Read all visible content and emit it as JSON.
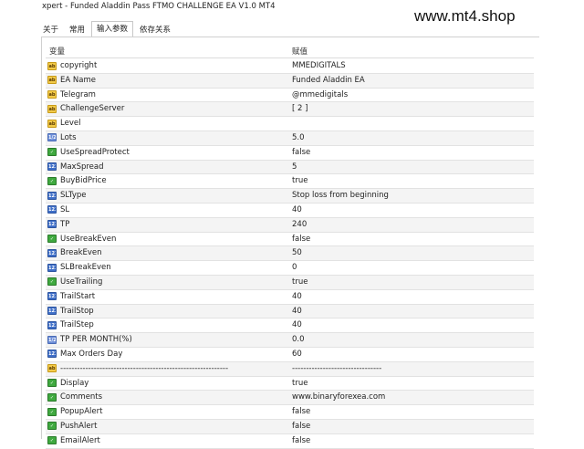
{
  "window": {
    "title": "xpert - Funded Aladdin Pass FTMO CHALLENGE EA V1.0 MT4",
    "watermark": "www.mt4.shop"
  },
  "tabs": [
    {
      "label": "关于"
    },
    {
      "label": "常用"
    },
    {
      "label": "输入参数"
    },
    {
      "label": "依存关系"
    }
  ],
  "active_tab": "输入参数",
  "columns": {
    "name": "变量",
    "value": "赋值"
  },
  "params": [
    {
      "icon": "text-type-icon",
      "name": "copyright",
      "value": "MMEDIGITALS"
    },
    {
      "icon": "text-type-icon",
      "name": "EA Name",
      "value": "Funded Aladdin EA"
    },
    {
      "icon": "text-type-icon",
      "name": "Telegram",
      "value": " @mmedigitals"
    },
    {
      "icon": "text-type-icon",
      "name": "ChallengeServer",
      "value": "[ 2 ]"
    },
    {
      "icon": "text-type-icon",
      "name": "Level",
      "value": ""
    },
    {
      "icon": "double-type-icon",
      "name": "Lots",
      "value": "5.0"
    },
    {
      "icon": "bool-type-icon",
      "name": "UseSpreadProtect",
      "value": "false"
    },
    {
      "icon": "int-type-icon",
      "name": "MaxSpread",
      "value": "5"
    },
    {
      "icon": "bool-type-icon",
      "name": "BuyBidPrice",
      "value": "true"
    },
    {
      "icon": "int-type-icon",
      "name": "SLType",
      "value": "Stop loss from beginning"
    },
    {
      "icon": "int-type-icon",
      "name": "SL",
      "value": "40"
    },
    {
      "icon": "int-type-icon",
      "name": "TP",
      "value": "240"
    },
    {
      "icon": "bool-type-icon",
      "name": "UseBreakEven",
      "value": "false"
    },
    {
      "icon": "int-type-icon",
      "name": "BreakEven",
      "value": "50"
    },
    {
      "icon": "int-type-icon",
      "name": "SLBreakEven",
      "value": "0"
    },
    {
      "icon": "bool-type-icon",
      "name": "UseTrailing",
      "value": "true"
    },
    {
      "icon": "int-type-icon",
      "name": "TrailStart",
      "value": "40"
    },
    {
      "icon": "int-type-icon",
      "name": "TrailStop",
      "value": "40"
    },
    {
      "icon": "int-type-icon",
      "name": "TrailStep",
      "value": "40"
    },
    {
      "icon": "double-type-icon",
      "name": "TP PER MONTH(%)",
      "value": "0.0"
    },
    {
      "icon": "int-type-icon",
      "name": "Max Orders Day",
      "value": "60"
    },
    {
      "icon": "text-type-icon",
      "name": "------------------------------------------------------------",
      "value": "--------------------------------"
    },
    {
      "icon": "bool-type-icon",
      "name": "Display",
      "value": "true"
    },
    {
      "icon": "bool-type-icon",
      "name": "Comments",
      "value": "www.binaryforexea.com"
    },
    {
      "icon": "bool-type-icon",
      "name": "PopupAlert",
      "value": "false"
    },
    {
      "icon": "bool-type-icon",
      "name": "PushAlert",
      "value": "false"
    },
    {
      "icon": "bool-type-icon",
      "name": "EmailAlert",
      "value": "false"
    }
  ],
  "icon_glyphs": {
    "text-type-icon": "ab",
    "int-type-icon": "123",
    "double-type-icon": "1/2",
    "bool-type-icon": "✓"
  },
  "colors": {
    "text_type": "#f3cb4a",
    "int_type": "#3f6fc8",
    "bool_type": "#3fa93f",
    "row_alt": "#f4f4f4"
  }
}
